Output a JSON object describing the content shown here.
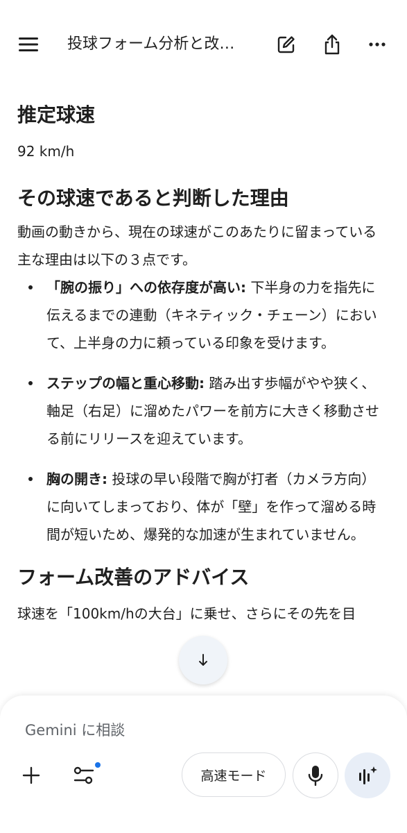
{
  "header": {
    "title": "投球フォーム分析と改…",
    "menu_icon": "menu-icon",
    "edit_icon": "edit-icon",
    "share_icon": "share-icon",
    "more_icon": "more-icon"
  },
  "content": {
    "speed_heading": "推定球速",
    "speed_value": "92 km/h",
    "reason_heading": "その球速であると判断した理由",
    "reason_intro": "動画の動きから、現在の球速がこのあたりに留まっている主な理由は以下の３点です。",
    "reasons": [
      {
        "lead": "「腕の振り」への依存度が高い:",
        "text": " 下半身の力を指先に伝えるまでの連動（キネティック・チェーン）において、上半身の力に頼っている印象を受けます。"
      },
      {
        "lead": "ステップの幅と重心移動:",
        "text": " 踏み出す歩幅がやや狭く、軸足（右足）に溜めたパワーを前方に大きく移動させる前にリリースを迎えています。"
      },
      {
        "lead": "胸の開き:",
        "text": " 投球の早い段階で胸が打者（カメラ方向）に向いてしまっており、体が「壁」を作って溜める時間が短いため、爆発的な加速が生まれていません。"
      }
    ],
    "advice_heading": "フォーム改善のアドバイス",
    "advice_partial": "球速を「100km/hの大台」に乗せ、さらにその先を目"
  },
  "composer": {
    "placeholder": "Gemini に相談",
    "mode_label": "高速モード",
    "accent_dot_color": "#1a73e8"
  }
}
